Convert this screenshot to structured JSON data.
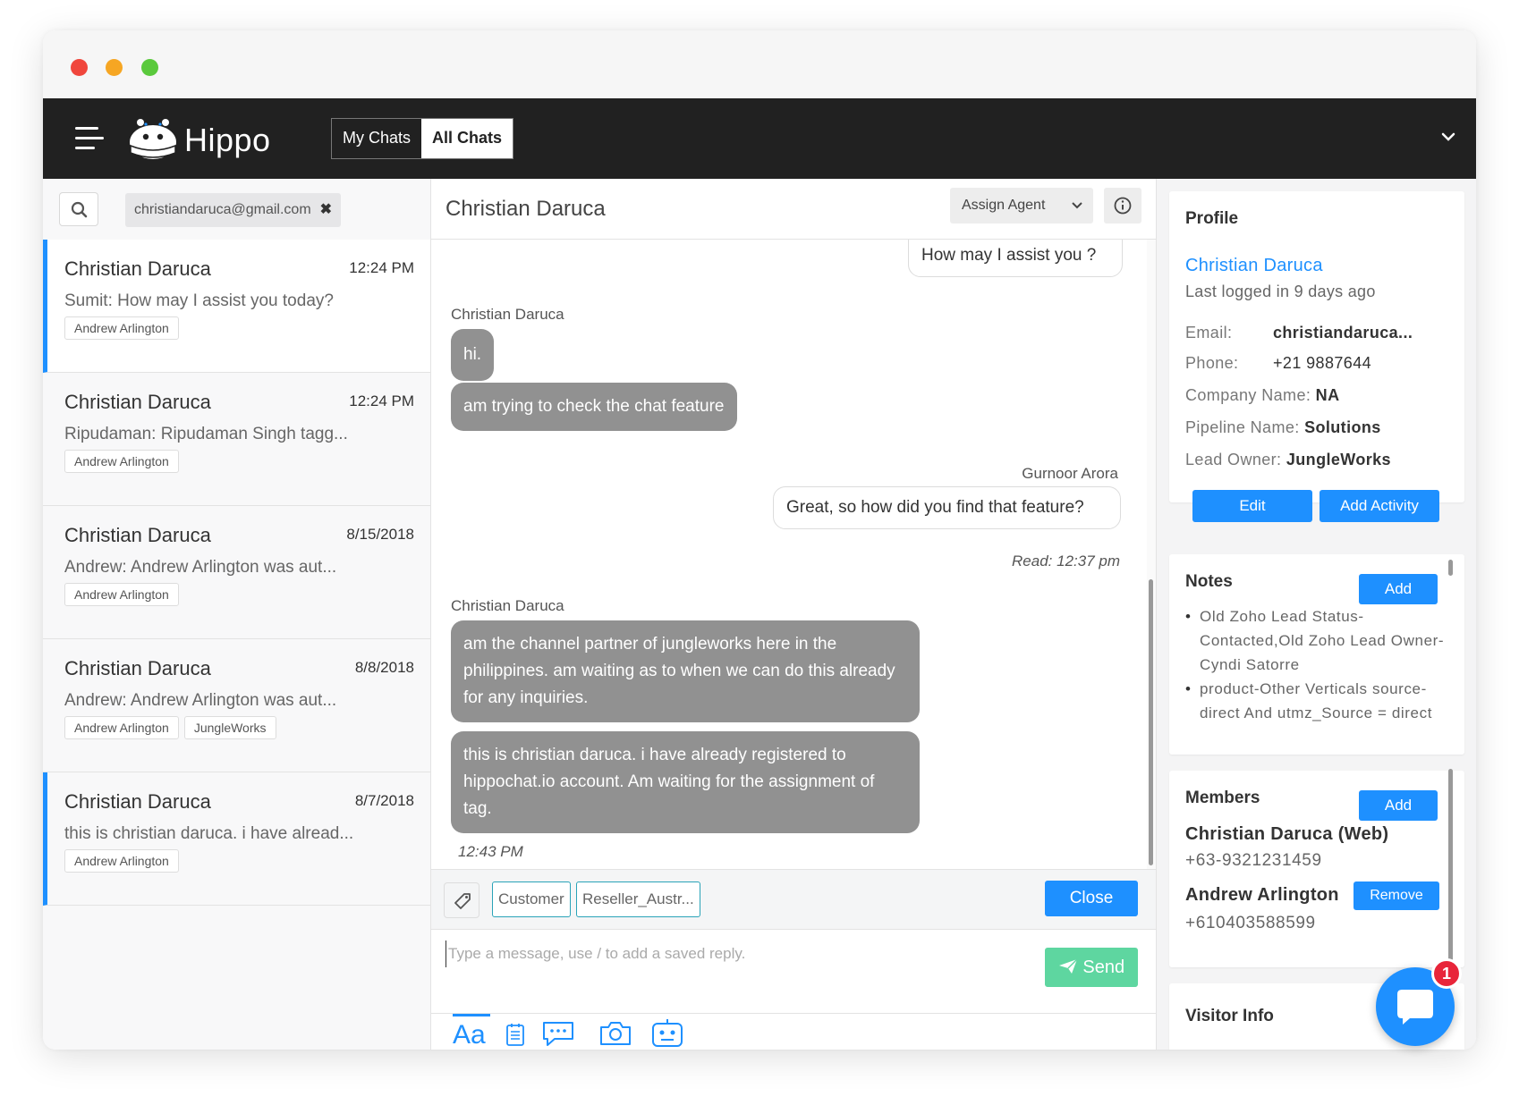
{
  "header": {
    "app_name": "Hippo",
    "tabs": [
      {
        "label": "My Chats",
        "active": false
      },
      {
        "label": "All Chats",
        "active": true
      }
    ]
  },
  "left": {
    "filter_email": "christiandaruca@gmail.com",
    "conversations": [
      {
        "name": "Christian Daruca",
        "time": "12:24 PM",
        "preview": "Sumit: How may I assist you today?",
        "tags": [
          "Andrew Arlington"
        ]
      },
      {
        "name": "Christian Daruca",
        "time": "12:24 PM",
        "preview": "Ripudaman: Ripudaman Singh tagg...",
        "tags": [
          "Andrew Arlington"
        ]
      },
      {
        "name": "Christian Daruca",
        "time": "8/15/2018",
        "preview": "Andrew: Andrew Arlington was aut...",
        "tags": [
          "Andrew Arlington"
        ]
      },
      {
        "name": "Christian Daruca",
        "time": "8/8/2018",
        "preview": "Andrew: Andrew Arlington was aut...",
        "tags": [
          "Andrew Arlington",
          "JungleWorks"
        ]
      },
      {
        "name": "Christian Daruca",
        "time": "8/7/2018",
        "preview": "this is christian daruca. i have alread...",
        "tags": [
          "Andrew Arlington"
        ]
      }
    ]
  },
  "chat": {
    "title": "Christian Daruca",
    "assign_agent": "Assign Agent",
    "messages": {
      "out1": "How may I assist you ?",
      "sender1": "Christian Daruca",
      "in1": "hi.",
      "in2": "am trying to check the chat feature",
      "sender2": "Gurnoor Arora",
      "out2": "Great, so how did you find that feature?",
      "read_status": "Read: 12:37 pm",
      "sender3": "Christian Daruca",
      "in3": "am the channel partner of jungleworks here in the philippines. am waiting as to when we can do this already for any inquiries.",
      "in4": "this is christian daruca. i have already registered to hippochat.io account. Am waiting for the assignment of tag.",
      "time3": "12:43 PM"
    },
    "tags": [
      "Customer",
      "Reseller_Austr..."
    ],
    "close_label": "Close",
    "composer_placeholder": "Type a message, use / to add a saved reply.",
    "send_label": "Send",
    "toolbar_text": "Aa"
  },
  "profile": {
    "section_title": "Profile",
    "name": "Christian Daruca",
    "last_logged": "Last logged in 9 days ago",
    "fields": [
      {
        "label": "Email:",
        "value": "christiandaruca..."
      },
      {
        "label": "Phone:",
        "value": "+21 9887644"
      },
      {
        "label": "Company Name:",
        "value": "NA"
      },
      {
        "label": "Pipeline Name:",
        "value": "Solutions"
      },
      {
        "label": "Lead Owner:",
        "value": "JungleWorks"
      }
    ],
    "edit_label": "Edit",
    "add_activity_label": "Add Activity"
  },
  "notes": {
    "title": "Notes",
    "add_label": "Add",
    "items": [
      "Old Zoho Lead Status- Contacted,Old Zoho Lead Owner- Cyndi Satorre",
      "product-Other Verticals source-direct And utmz_Source = direct"
    ]
  },
  "members": {
    "title": "Members",
    "add_label": "Add",
    "list": [
      {
        "name": "Christian Daruca (Web)",
        "phone": "+63-9321231459"
      },
      {
        "name": "Andrew Arlington",
        "phone": "+610403588599",
        "action": "Remove"
      }
    ]
  },
  "visitor_info": {
    "title": "Visitor Info"
  },
  "launcher": {
    "badge": "1"
  },
  "colors": {
    "accent": "#1e90ff",
    "header_bg": "#212121",
    "incoming_bubble": "#919191",
    "send": "#5ed6a0",
    "badge": "#e8253a"
  }
}
